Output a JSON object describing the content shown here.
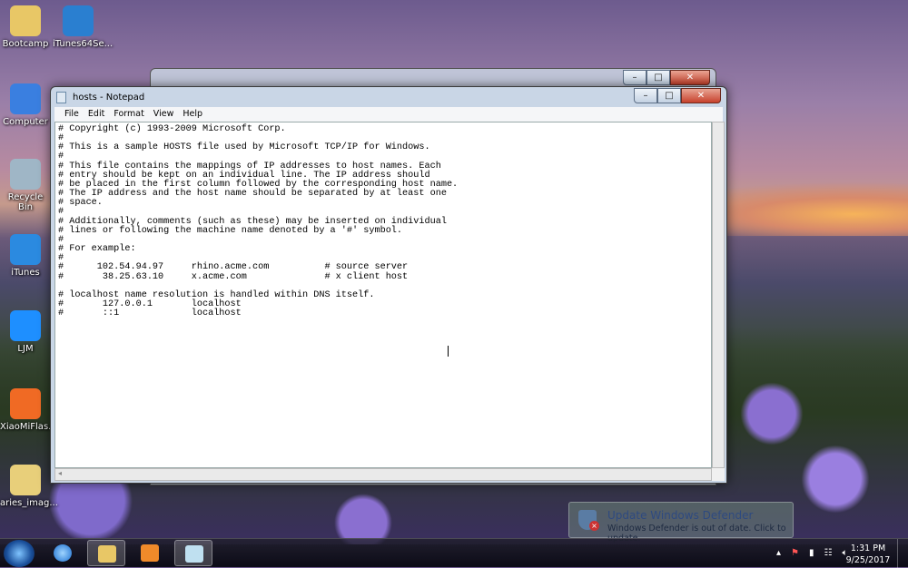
{
  "desktop": {
    "icons": [
      {
        "label": "Bootcamp",
        "icon": "folder-user-icon",
        "color": "#e8c766"
      },
      {
        "label": "iTunes64Se...",
        "icon": "itunes-setup-icon",
        "color": "#2a7fd0"
      },
      {
        "label": "Computer",
        "icon": "computer-icon",
        "color": "#3a7fe0"
      },
      {
        "label": "Recycle Bin",
        "icon": "recycle-bin-icon",
        "color": "#9fb6c6"
      },
      {
        "label": "iTunes",
        "icon": "itunes-icon",
        "color": "#2b8ae0"
      },
      {
        "label": "LJM",
        "icon": "asterisk-app-icon",
        "color": "#1e8fff"
      },
      {
        "label": "XiaoMiFlas...",
        "icon": "mi-icon",
        "color": "#f06a24"
      },
      {
        "label": "aries_imag...",
        "icon": "folder-icon",
        "color": "#e8cf7a"
      }
    ]
  },
  "notepad": {
    "title": "hosts - Notepad",
    "menu": [
      "File",
      "Edit",
      "Format",
      "View",
      "Help"
    ],
    "content": [
      "# Copyright (c) 1993-2009 Microsoft Corp.",
      "#",
      "# This is a sample HOSTS file used by Microsoft TCP/IP for Windows.",
      "#",
      "# This file contains the mappings of IP addresses to host names. Each",
      "# entry should be kept on an individual line. The IP address should",
      "# be placed in the first column followed by the corresponding host name.",
      "# The IP address and the host name should be separated by at least one",
      "# space.",
      "#",
      "# Additionally, comments (such as these) may be inserted on individual",
      "# lines or following the machine name denoted by a '#' symbol.",
      "#",
      "# For example:",
      "#",
      "#      102.54.94.97     rhino.acme.com          # source server",
      "#       38.25.63.10     x.acme.com              # x client host",
      "",
      "# localhost name resolution is handled within DNS itself.",
      "#\t127.0.0.1       localhost",
      "#\t::1             localhost"
    ]
  },
  "notification": {
    "title": "Update Windows Defender",
    "message": "Windows Defender is out of date. Click to update."
  },
  "taskbar": {
    "time": "1:31 PM",
    "date": "9/25/2017"
  }
}
